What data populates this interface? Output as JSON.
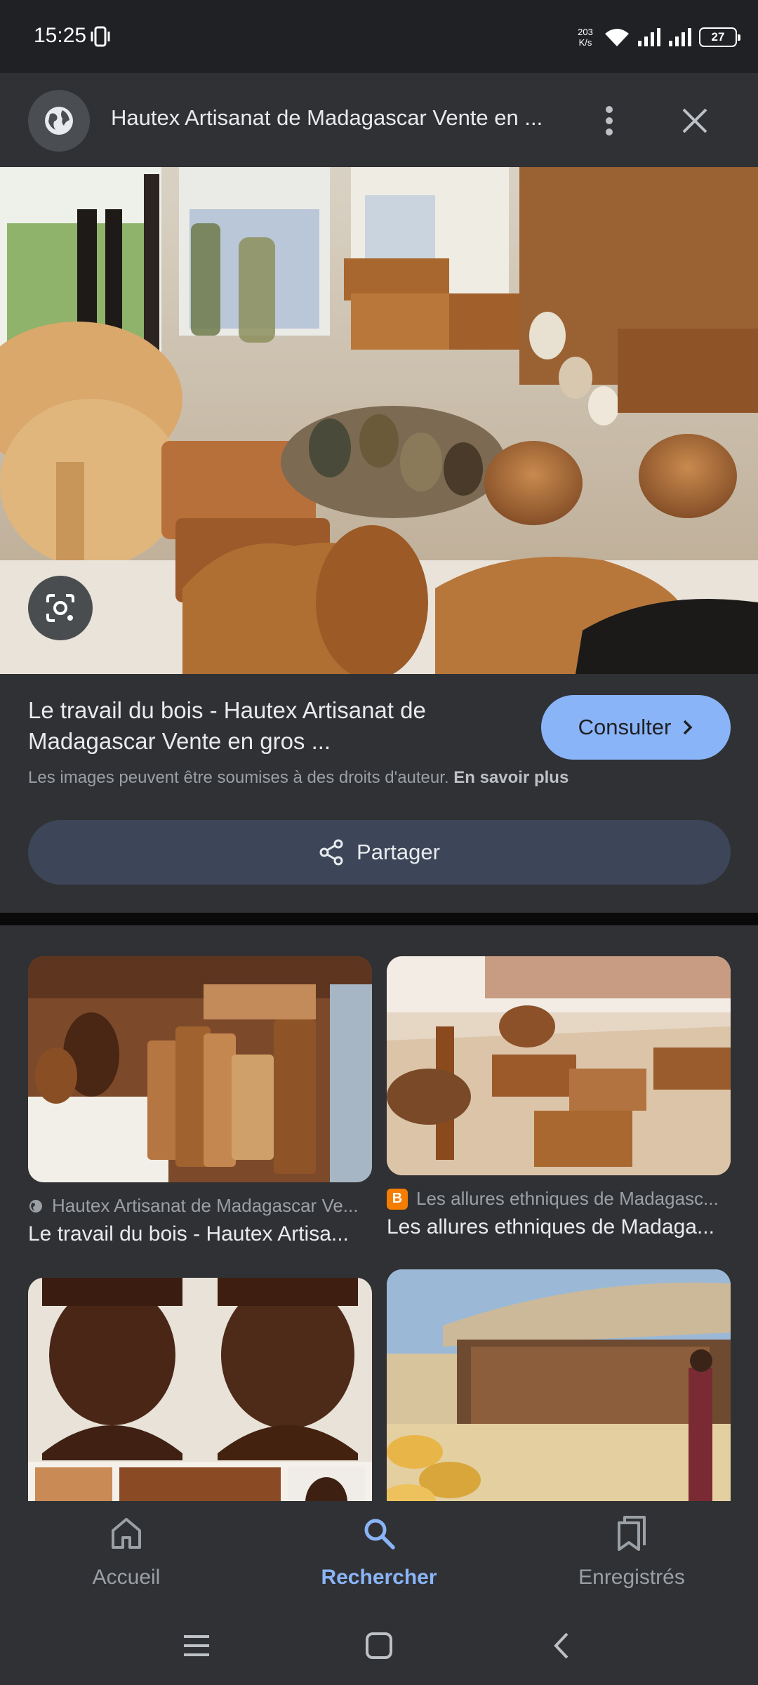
{
  "status_bar": {
    "time": "15:25",
    "net_speed_value": "203",
    "net_speed_unit": "K/s",
    "battery": "27"
  },
  "header": {
    "title": "Hautex Artisanat de Madagascar Vente en ..."
  },
  "result": {
    "title": "Le travail du bois - Hautex Artisanat de Madagascar Vente en gros ...",
    "visit_label": "Consulter",
    "copyright_text": "Les images peuvent être soumises à des droits d'auteur.",
    "learn_more_label": "En savoir plus",
    "share_label": "Partager"
  },
  "related": [
    {
      "source": "Hautex Artisanat de Madagascar Ve...",
      "title": "Le travail du bois - Hautex Artisa...",
      "source_icon": "globe-icon"
    },
    {
      "source": "Les allures ethniques de Madagasc...",
      "title": "Les allures ethniques de Madaga...",
      "source_icon": "blogger-icon"
    },
    {
      "source": "",
      "title": "",
      "source_icon": ""
    },
    {
      "source": "",
      "title": "",
      "source_icon": ""
    }
  ],
  "bottom_nav": {
    "home_label": "Accueil",
    "search_label": "Rechercher",
    "saved_label": "Enregistrés"
  },
  "colors": {
    "accent": "#8ab4f8",
    "background": "#202124",
    "surface": "#303134"
  }
}
